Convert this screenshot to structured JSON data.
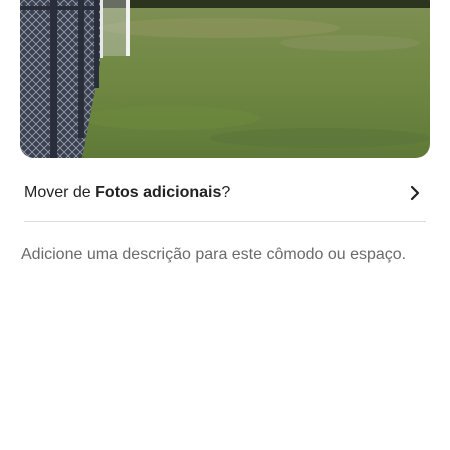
{
  "photo": {
    "icon": "soccer-field-photo"
  },
  "move_row": {
    "prefix": "Mover de ",
    "album": "Fotos adicionais",
    "suffix": "?",
    "icon": "chevron-right-icon"
  },
  "description_prompt": "Adicione uma descrição para este cômodo ou espaço."
}
